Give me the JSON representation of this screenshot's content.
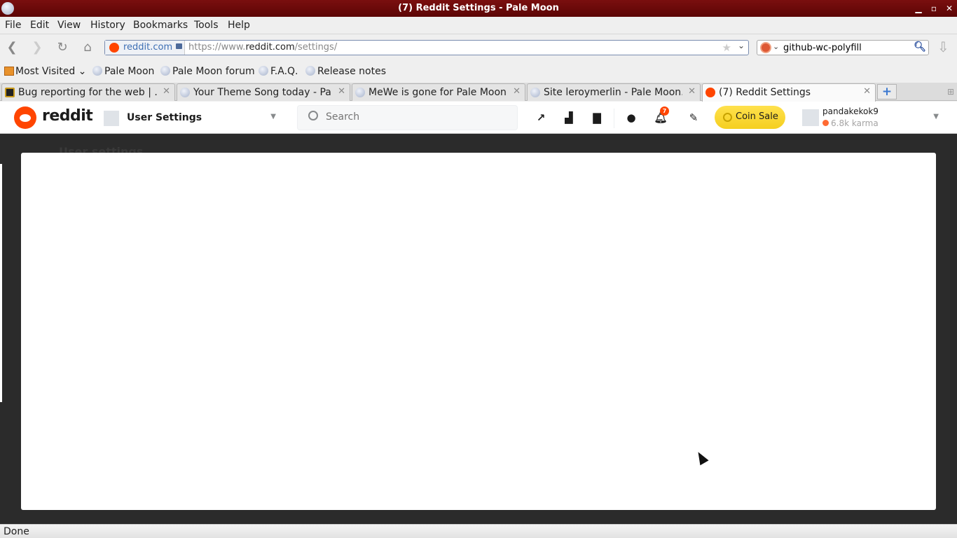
{
  "window": {
    "title": "(7) Reddit Settings - Pale Moon",
    "controls": {
      "minimize": "▁",
      "maximize": "▫",
      "close": "✕"
    }
  },
  "menu": [
    "File",
    "Edit",
    "View",
    "History",
    "Bookmarks",
    "Tools",
    "Help"
  ],
  "nav": {
    "back_icon": "back-arrow-icon",
    "forward_icon": "forward-arrow-icon",
    "reload_icon": "reload-icon",
    "home_icon": "home-icon",
    "url_identity": "reddit.com",
    "url_prefix": "https://www.",
    "url_domain": "reddit.com",
    "url_path": "/settings/",
    "search_value": "github-wc-polyfill"
  },
  "bookmarks": [
    {
      "label": "Most Visited",
      "icon": "folder-icon",
      "dropdown": true
    },
    {
      "label": "Pale Moon",
      "icon": "globe-icon"
    },
    {
      "label": "Pale Moon forum",
      "icon": "globe-icon"
    },
    {
      "label": "F.A.Q.",
      "icon": "globe-icon"
    },
    {
      "label": "Release notes",
      "icon": "globe-icon"
    }
  ],
  "tabs": [
    {
      "label": "Bug reporting for the web | ...",
      "icon": "bug-icon",
      "active": false
    },
    {
      "label": "Your Theme Song today - Pa...",
      "icon": "globe-icon",
      "active": false
    },
    {
      "label": "MeWe is gone for Pale Moon...",
      "icon": "globe-icon",
      "active": false
    },
    {
      "label": "Site leroymerlin - Pale Moon...",
      "icon": "globe-icon",
      "active": false
    },
    {
      "label": "(7) Reddit Settings",
      "icon": "reddit-icon",
      "active": true
    }
  ],
  "reddit": {
    "wordmark": "reddit",
    "community": "User Settings",
    "search_placeholder": "Search",
    "notification_count": "7",
    "coin_button": "Coin Sale",
    "username": "pandakekok9",
    "karma": "6.8k karma",
    "page_heading": "User settings",
    "brand_color": "#ff4500",
    "coin_color": "#ffd635"
  },
  "status": "Done"
}
